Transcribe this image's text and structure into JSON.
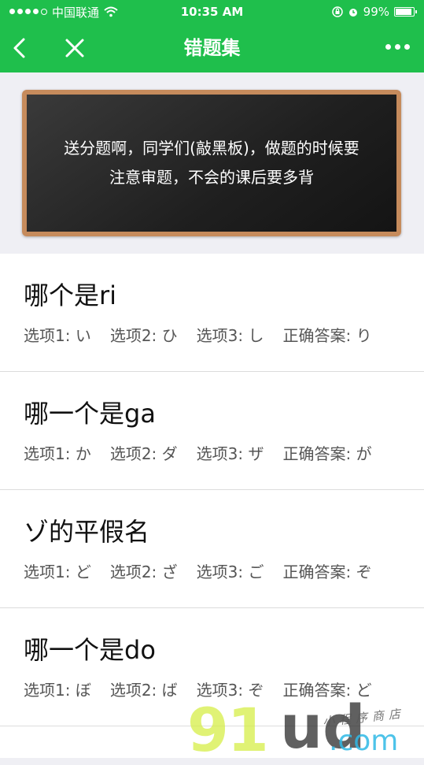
{
  "status_bar": {
    "carrier": "中国联通",
    "time": "10:35 AM",
    "battery": "99%"
  },
  "nav": {
    "title": "错题集"
  },
  "banner": {
    "line1": "送分题啊，同学们(敲黑板)，做题的时候要",
    "line2": "注意审题，不会的课后要多背"
  },
  "questions": [
    {
      "question": "哪个是ri",
      "opt1": "选项1: い",
      "opt2": "选项2: ひ",
      "opt3": "选项3: し",
      "answer": "正确答案: り"
    },
    {
      "question": "哪一个是ga",
      "opt1": "选项1: か",
      "opt2": "选项2: ダ",
      "opt3": "选项3: ザ",
      "answer": "正确答案: が"
    },
    {
      "question": "ゾ的平假名",
      "opt1": "选项1: ど",
      "opt2": "选项2: ざ",
      "opt3": "选项3: ご",
      "answer": "正确答案: ぞ"
    },
    {
      "question": "哪一个是do",
      "opt1": "选项1: ぼ",
      "opt2": "选项2: ば",
      "opt3": "选项3: ぞ",
      "answer": "正确答案: ど"
    }
  ],
  "watermark": {
    "part1": "91",
    "part2": "ud",
    "domain": ".com",
    "cn": "小程序商店"
  }
}
